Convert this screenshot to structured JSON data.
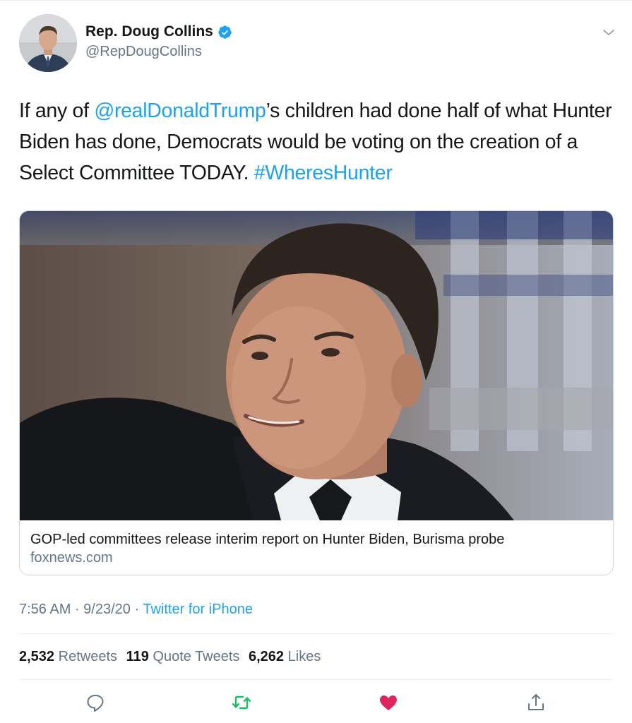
{
  "colors": {
    "link": "#1da1f2",
    "secondary_text": "#657786",
    "primary_text": "#14171a",
    "like": "#e0245e",
    "retweet": "#17bf63",
    "divider": "#e6ecf0"
  },
  "author": {
    "name": "Rep. Doug Collins",
    "handle": "@RepDougCollins",
    "verified_icon": "verified-badge-icon",
    "menu_icon": "chevron-down-icon"
  },
  "tweet": {
    "text_part1": "If any of ",
    "mention": "@realDonaldTrump",
    "text_part2": "’s children had done half of what Hunter Biden has done, Democrats would be voting on the creation of a Select Committee TODAY. ",
    "hashtag": "#WheresHunter"
  },
  "card": {
    "title": "GOP-led committees release interim report on Hunter Biden, Burisma probe",
    "domain": "foxnews.com"
  },
  "meta": {
    "time": "7:56 AM",
    "separator1": " · ",
    "date": "9/23/20",
    "separator2": " · ",
    "source": "Twitter for iPhone"
  },
  "stats": {
    "retweets_count": "2,532",
    "retweets_label": "Retweets",
    "quotes_count": "119",
    "quotes_label": "Quote Tweets",
    "likes_count": "6,262",
    "likes_label": "Likes"
  },
  "actions": {
    "reply_icon": "reply-icon",
    "retweet_icon": "retweet-icon",
    "like_icon": "heart-icon",
    "share_icon": "share-icon"
  }
}
